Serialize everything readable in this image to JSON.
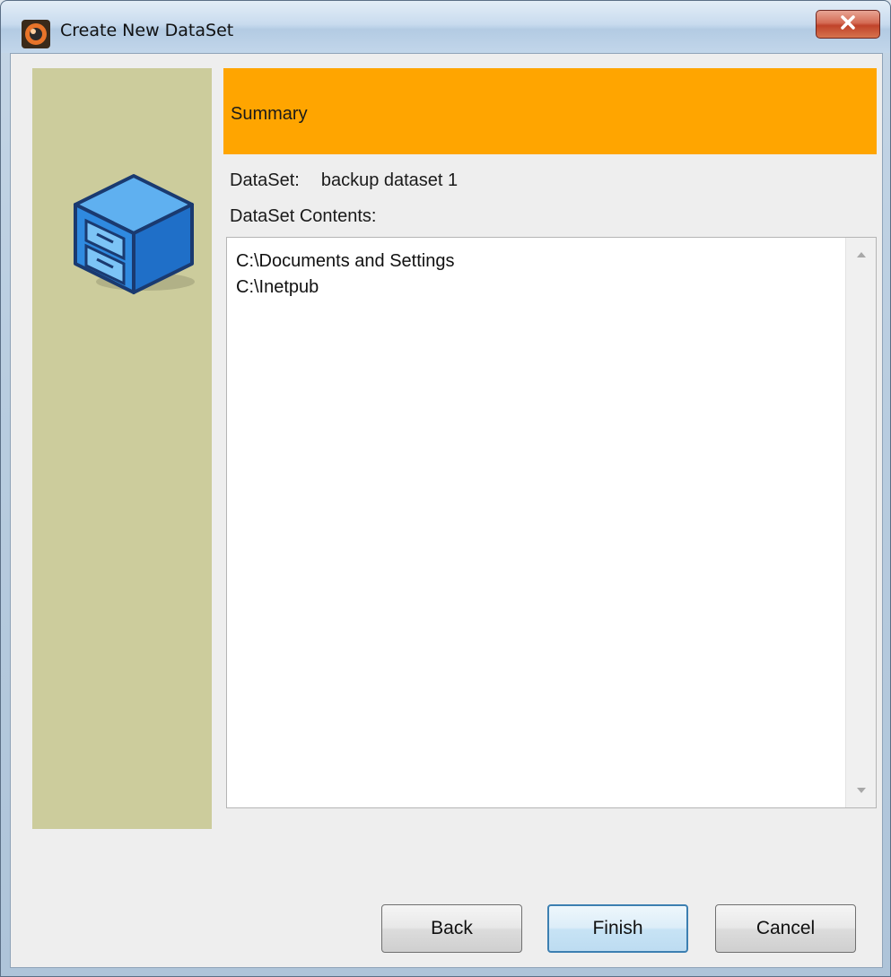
{
  "window": {
    "title": "Create New DataSet",
    "app_icon": "app-logo-icon",
    "close_icon": "close-icon"
  },
  "side_panel": {
    "icon": "file-cabinet-icon",
    "color": "#cccc9c"
  },
  "header": {
    "label": "Summary",
    "color": "#ffa500"
  },
  "dataset": {
    "label": "DataSet:",
    "value": "backup dataset 1"
  },
  "contents": {
    "label": "DataSet Contents:",
    "items": [
      "C:\\Documents and Settings",
      "C:\\Inetpub"
    ]
  },
  "buttons": {
    "back": "Back",
    "finish": "Finish",
    "cancel": "Cancel"
  }
}
